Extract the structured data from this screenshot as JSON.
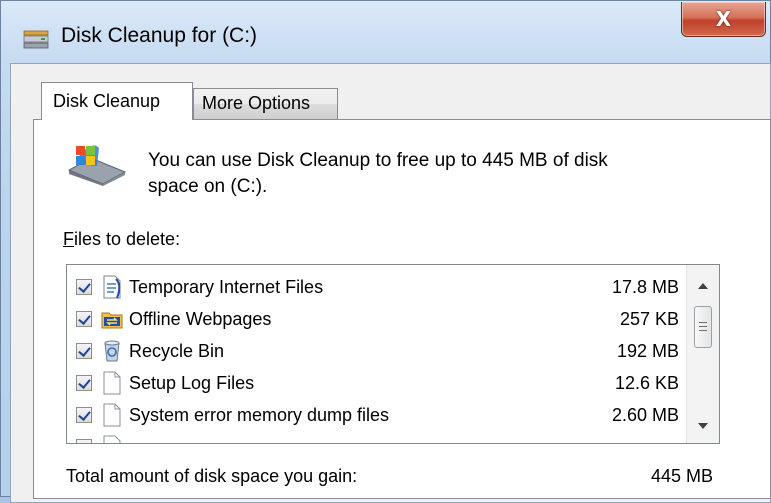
{
  "window": {
    "title": "Disk Cleanup for  (C:)",
    "close_label": "X"
  },
  "tabs": [
    {
      "label": "Disk Cleanup",
      "active": true
    },
    {
      "label": "More Options",
      "active": false
    }
  ],
  "intro": {
    "line1": "You can use Disk Cleanup to free up to 445 MB of disk",
    "line2": "space on  (C:)."
  },
  "files_label_underline": "F",
  "files_label_rest": "iles to delete:",
  "files": [
    {
      "name": "Temporary Internet Files",
      "size": "17.8 MB",
      "checked": true,
      "icon": "document-icon"
    },
    {
      "name": "Offline Webpages",
      "size": "257 KB",
      "checked": true,
      "icon": "sync-folder-icon"
    },
    {
      "name": "Recycle Bin",
      "size": "192 MB",
      "checked": true,
      "icon": "recycle-bin-icon"
    },
    {
      "name": "Setup Log Files",
      "size": "12.6 KB",
      "checked": true,
      "icon": "blank-file-icon"
    },
    {
      "name": "System error memory dump files",
      "size": "2.60 MB",
      "checked": true,
      "icon": "blank-file-icon"
    }
  ],
  "total": {
    "label": "Total amount of disk space you gain:",
    "value": "445 MB"
  },
  "colors": {
    "frame": "#b5cfec",
    "close_button": "#c0412a",
    "checkmark": "#21409a"
  }
}
